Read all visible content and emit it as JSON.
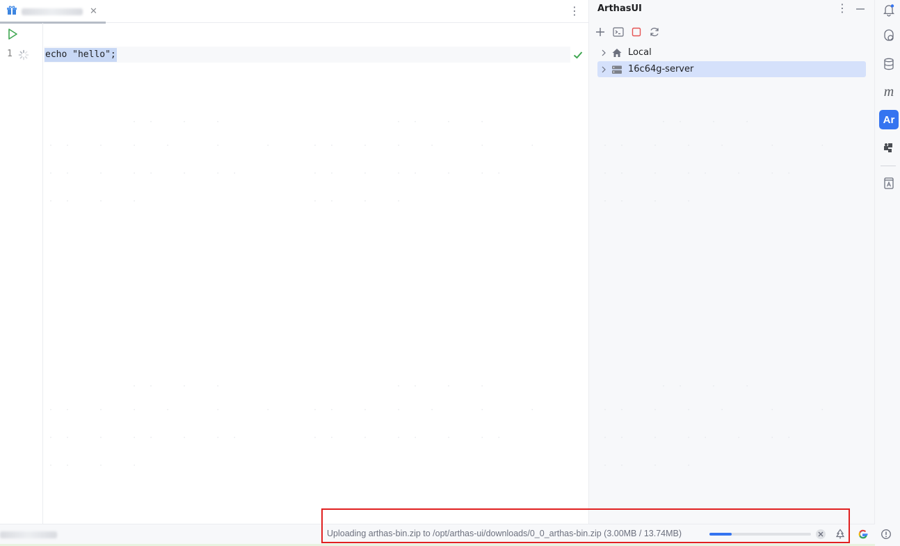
{
  "editor": {
    "line_number": "1",
    "code": "echo \"hello\";"
  },
  "panel": {
    "title": "ArthasUI",
    "tree": [
      {
        "label": "Local",
        "icon": "home-icon",
        "selected": false
      },
      {
        "label": "16c64g-server",
        "icon": "server-icon",
        "selected": true
      }
    ]
  },
  "tool_strip": {
    "arthas_label": "Ar",
    "maven_label": "m"
  },
  "status": {
    "upload_text": "Uploading arthas-bin.zip to /opt/arthas-ui/downloads/0_0_arthas-bin.zip (3.00MB / 13.74MB)",
    "progress": 0.218
  },
  "colors": {
    "accent": "#3574f0",
    "selection": "#d5e1fb",
    "highlight_border": "#e02020",
    "success": "#3ea650"
  }
}
